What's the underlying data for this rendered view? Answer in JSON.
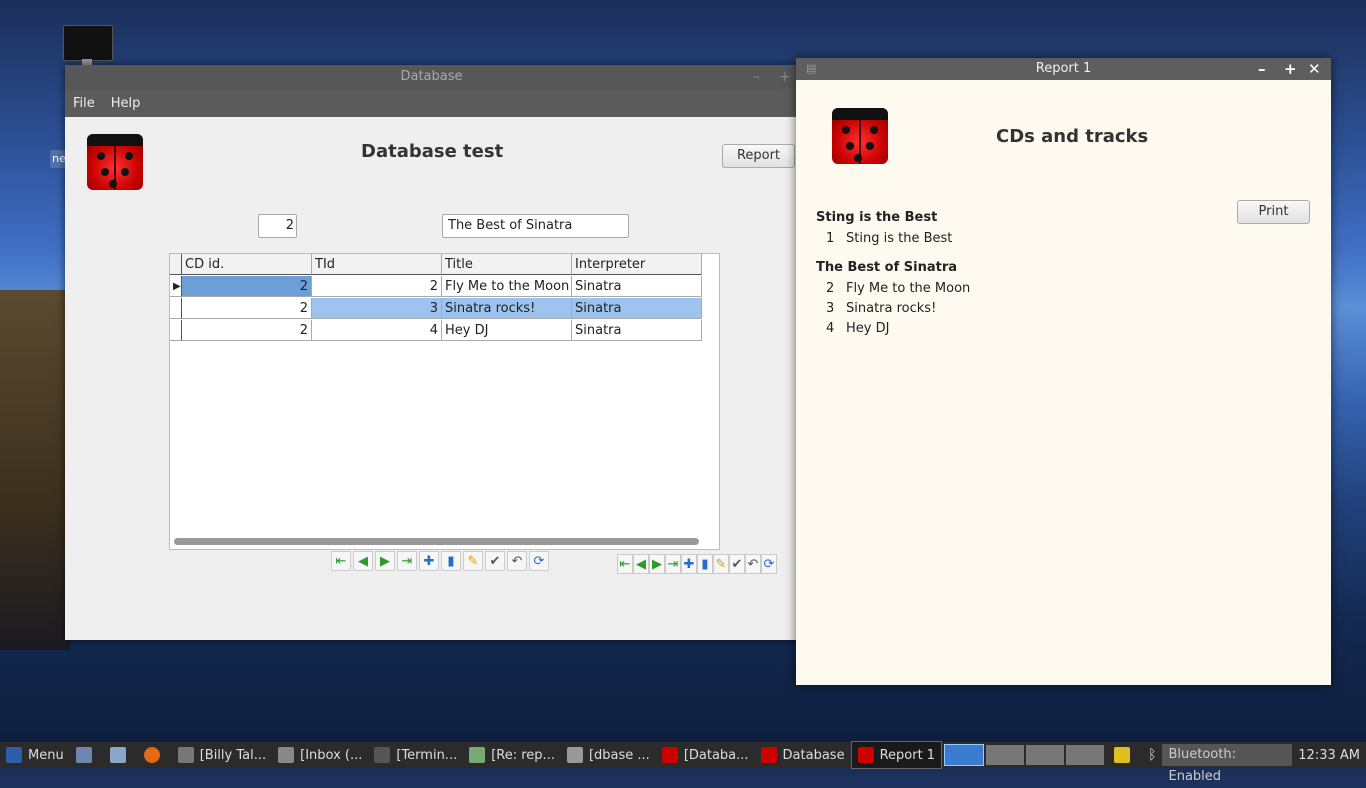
{
  "desktop": {
    "tag_label": "ne"
  },
  "db_window": {
    "title": "Database",
    "menu": [
      "File",
      "Help"
    ],
    "heading": "Database test",
    "report_button": "Report",
    "id_field_value": "2",
    "title_field_value": "The Best of Sinatra",
    "grid": {
      "columns": [
        "CD id.",
        "TId",
        "Title",
        "Interpreter"
      ],
      "rows": [
        {
          "cd_id": "2",
          "tid": "2",
          "title": "Fly Me to the Moon",
          "interpreter": "Sinatra"
        },
        {
          "cd_id": "2",
          "tid": "3",
          "title": "Sinatra rocks!",
          "interpreter": "Sinatra"
        },
        {
          "cd_id": "2",
          "tid": "4",
          "title": "Hey DJ",
          "interpreter": "Sinatra"
        }
      ]
    }
  },
  "report_window": {
    "title": "Report 1",
    "heading": "CDs and tracks",
    "print_button": "Print",
    "groups": [
      {
        "name": "Sting is the Best",
        "tracks": [
          {
            "no": "1",
            "title": "Sting is the Best"
          }
        ]
      },
      {
        "name": "The Best of Sinatra",
        "tracks": [
          {
            "no": "2",
            "title": "Fly Me to the Moon"
          },
          {
            "no": "3",
            "title": "Sinatra rocks!"
          },
          {
            "no": "4",
            "title": "Hey DJ"
          }
        ]
      }
    ]
  },
  "taskbar": {
    "menu_label": "Menu",
    "items": [
      "[Billy Tal...",
      "[Inbox (...",
      "[Termin...",
      "[Re: rep...",
      "[dbase ...",
      "[Databa...",
      "Database",
      "Report 1"
    ],
    "bluetooth": "Bluetooth: Enabled",
    "clock": "12:33 AM"
  }
}
